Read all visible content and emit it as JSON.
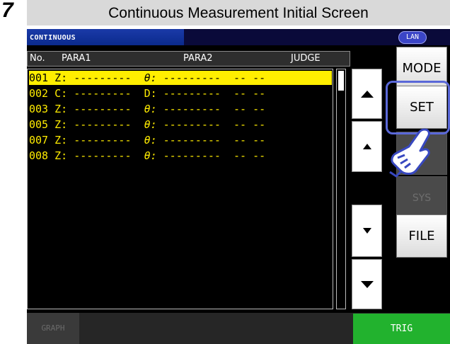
{
  "step_number": "7",
  "caption": "Continuous Measurement Initial Screen",
  "titlebar": {
    "title": "CONTINUOUS",
    "lan_badge": "LAN"
  },
  "table_header": {
    "no": "No.",
    "para1": "PARA1",
    "para2": "PARA2",
    "judge": "JUDGE"
  },
  "rows": [
    {
      "no": "001",
      "p1": "Z:",
      "v1": "---------",
      "p2": "θ:",
      "v2": "---------",
      "judge": "-- --",
      "selected": true
    },
    {
      "no": "002",
      "p1": "C:",
      "v1": "---------",
      "p2": "D:",
      "v2": "---------",
      "judge": "-- --"
    },
    {
      "no": "003",
      "p1": "Z:",
      "v1": "---------",
      "p2": "θ:",
      "v2": "---------",
      "judge": "-- --"
    },
    {
      "no": "005",
      "p1": "Z:",
      "v1": "---------",
      "p2": "θ:",
      "v2": "---------",
      "judge": "-- --"
    },
    {
      "no": "007",
      "p1": "Z:",
      "v1": "---------",
      "p2": "θ:",
      "v2": "---------",
      "judge": "-- --"
    },
    {
      "no": "008",
      "p1": "Z:",
      "v1": "---------",
      "p2": "θ:",
      "v2": "---------",
      "judge": "-- --"
    }
  ],
  "side_buttons": {
    "mode": "MODE",
    "set": "SET",
    "sys": "SYS",
    "file": "FILE"
  },
  "bottom": {
    "graph": "GRAPH",
    "trig": "TRIG"
  },
  "colors": {
    "row_text": "#ffec00",
    "selected_row": "#ffee00",
    "title_blue": "#1a3aa8",
    "trig_green": "#22b22e",
    "highlight": "#5a68d8"
  }
}
